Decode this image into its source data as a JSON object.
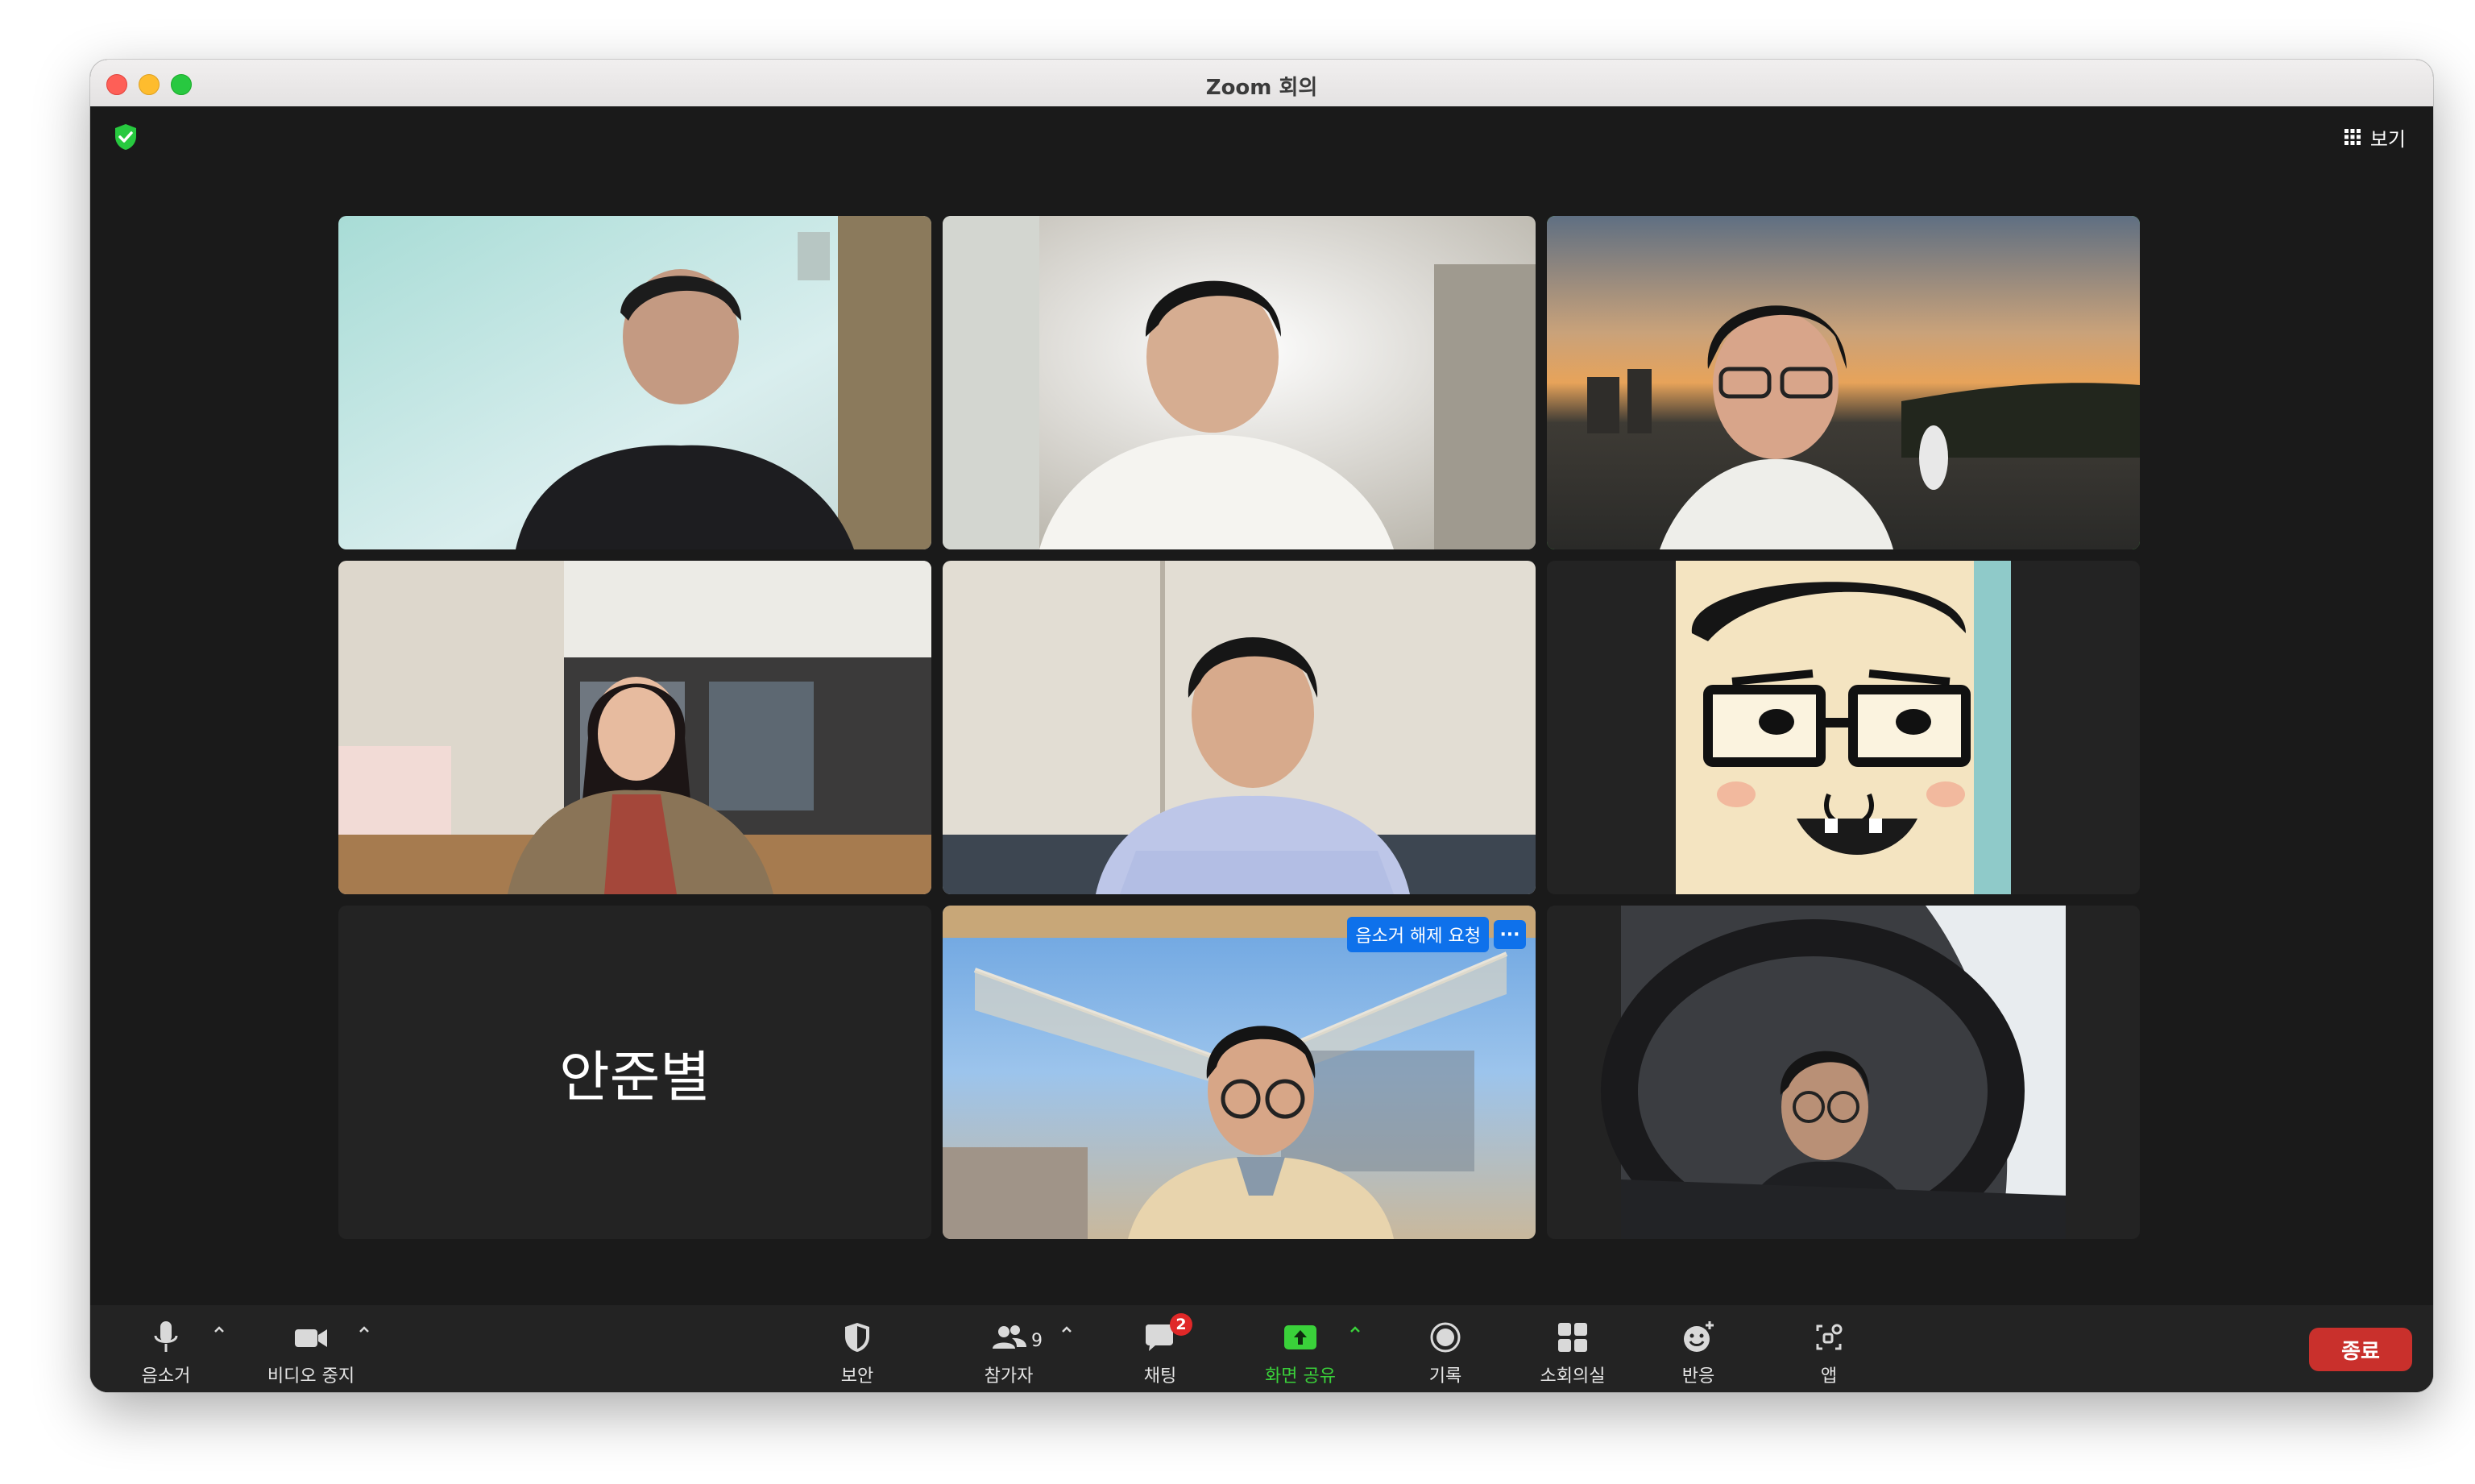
{
  "window": {
    "title": "Zoom 회의"
  },
  "header": {
    "view_label": "보기",
    "security_icon": "shield-check-icon",
    "accent": "#27c93f"
  },
  "participants": [
    {
      "id": "p1",
      "scene": "man-at-window-wall"
    },
    {
      "id": "p2",
      "scene": "man-white-shirt-room"
    },
    {
      "id": "p3",
      "scene": "man-sunset-background",
      "active_speaker": true
    },
    {
      "id": "p4",
      "scene": "woman-in-office"
    },
    {
      "id": "p5",
      "scene": "man-striped-shirt"
    },
    {
      "id": "p6",
      "scene": "cartoon-avatar"
    },
    {
      "id": "p7",
      "name": "안준별",
      "video_off": true
    },
    {
      "id": "p8",
      "scene": "man-glasses-atrium",
      "unmute_request_label": "음소거 해제 요청",
      "more_label": "···"
    },
    {
      "id": "p9",
      "scene": "man-driving-car"
    }
  ],
  "toolbar": {
    "mute_label": "음소거",
    "video_label": "비디오 중지",
    "security_label": "보안",
    "participants_label": "참가자",
    "participants_count": "9",
    "chat_label": "채팅",
    "chat_badge": "2",
    "share_label": "화면 공유",
    "record_label": "기록",
    "breakout_label": "소회의실",
    "reactions_label": "반응",
    "apps_label": "앱",
    "end_label": "종료",
    "colors": {
      "share": "#3ad13a",
      "end": "#c9302c",
      "badge": "#e02828",
      "unmute_request": "#0e71eb"
    }
  }
}
